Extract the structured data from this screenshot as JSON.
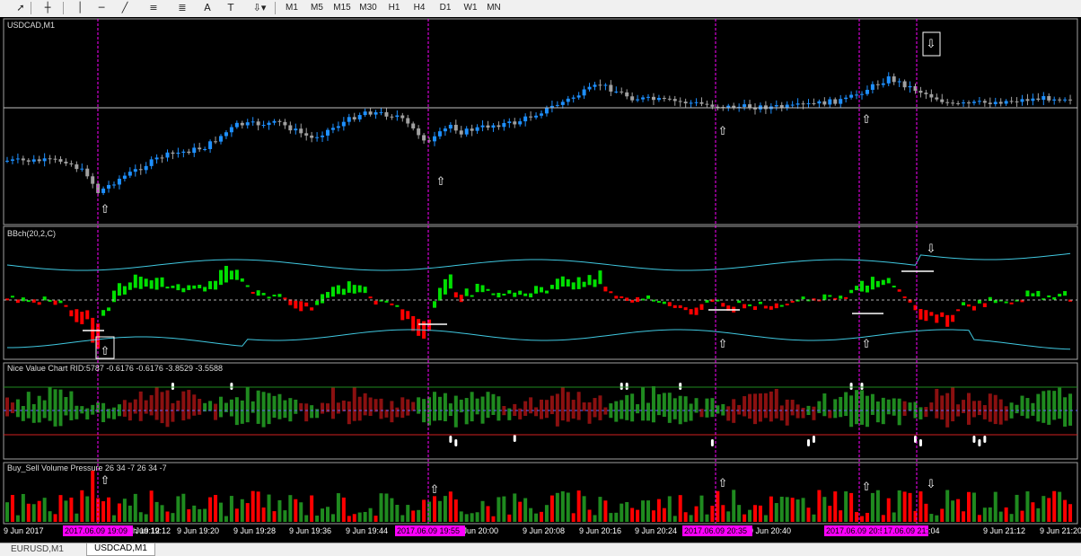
{
  "toolbar": {
    "tools": [
      {
        "name": "cursor-icon",
        "glyph": "➚"
      },
      {
        "name": "crosshair-icon",
        "glyph": "┼"
      },
      {
        "name": "vertical-line-icon",
        "glyph": "│"
      },
      {
        "name": "horizontal-line-icon",
        "glyph": "─"
      },
      {
        "name": "trendline-icon",
        "glyph": "╱"
      },
      {
        "name": "equidistant-channel-icon",
        "glyph": "≡"
      },
      {
        "name": "fibonacci-icon",
        "glyph": "≣"
      },
      {
        "name": "text-icon",
        "glyph": "A"
      },
      {
        "name": "text-label-icon",
        "glyph": "T"
      },
      {
        "name": "arrows-dropdown-icon",
        "glyph": "⇩▾"
      }
    ],
    "timeframes": [
      "M1",
      "M5",
      "M15",
      "M30",
      "H1",
      "H4",
      "D1",
      "W1",
      "MN"
    ]
  },
  "panes": {
    "main_label": "USDCAD,M1",
    "bbch_label": "BBch(20,2,C)",
    "nvc_label": "Nice Value Chart RID:5787 -0.6176 -0.6176 -3.8529 -3.5588",
    "bsvp_label": "Buy_Sell Volume Pressure 26 34 -7 26 34 -7"
  },
  "time_axis": {
    "labels": [
      "9 Jun 2017",
      "9 Jun 19:12",
      "9 Jun 19:20",
      "9 Jun 19:28",
      "9 Jun 19:36",
      "9 Jun 19:44",
      "9 Jun 20:00",
      "9 Jun 20:08",
      "9 Jun 20:16",
      "9 Jun 20:24",
      "9 Jun 20:40",
      "9 Jun 21:12",
      "9 Jun 21:20"
    ],
    "highlights": [
      "2017.06.09 19:09",
      "2017.06.09 19:55",
      "2017.06.09 20:35",
      "2017.06.09 20:55",
      "17.06.09 21:03"
    ],
    "partial": [
      "h 19:12",
      ":04"
    ]
  },
  "tabs": [
    {
      "label": "EURUSD,M1",
      "active": false
    },
    {
      "label": "USDCAD,M1",
      "active": true
    }
  ],
  "colors": {
    "background": "#000000",
    "bull_candle": "#1e90ff",
    "bear_candle": "#a0a0a0",
    "green": "#00e000",
    "red": "#ff0000",
    "dark_green": "#1f8a1f",
    "dark_red": "#8b1010",
    "band": "#40c8e0",
    "marker": "#ff00ff"
  }
}
